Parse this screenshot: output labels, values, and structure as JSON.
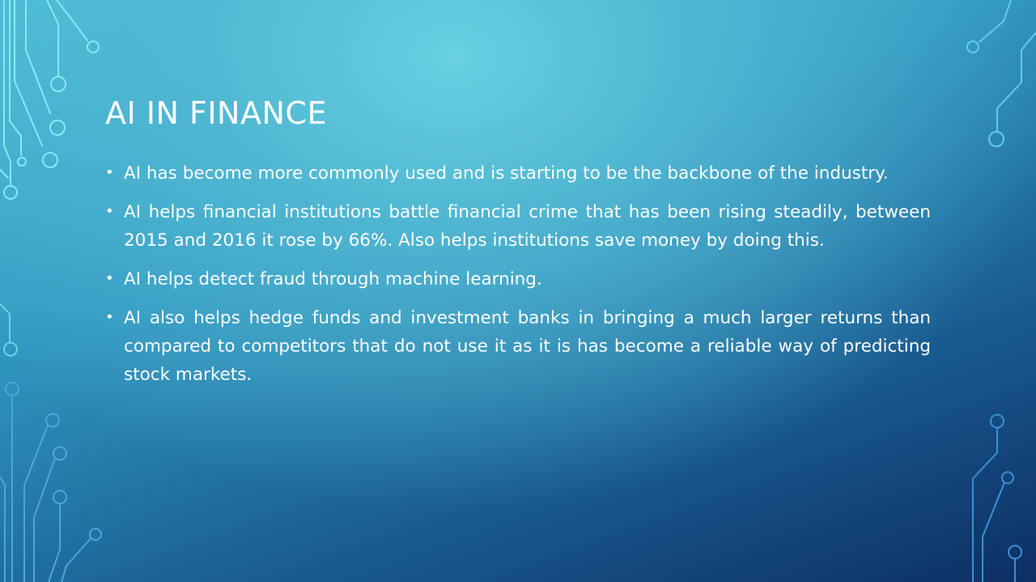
{
  "slide": {
    "title": "AI IN FINANCE",
    "bullets": [
      {
        "text": "AI has become more commonly used and is starting to be the backbone of the industry."
      },
      {
        "text": "AI helps financial institutions battle financial crime that has been rising steadily, between 2015 and 2016 it rose by 66%. Also helps institutions save money by doing this."
      },
      {
        "text": "AI helps detect fraud through machine learning."
      },
      {
        "text": "AI also helps hedge funds and investment banks in bringing a much larger returns than compared to competitors that do not use it as it is has become a reliable way of predicting stock markets."
      }
    ]
  },
  "theme": {
    "circuit_color_light": "#7fe6f2",
    "circuit_color_dark": "#3f8fd6",
    "text_color": "#ffffff"
  },
  "icons": {
    "bullet": "•",
    "decoration": "circuit-trace-icon"
  }
}
